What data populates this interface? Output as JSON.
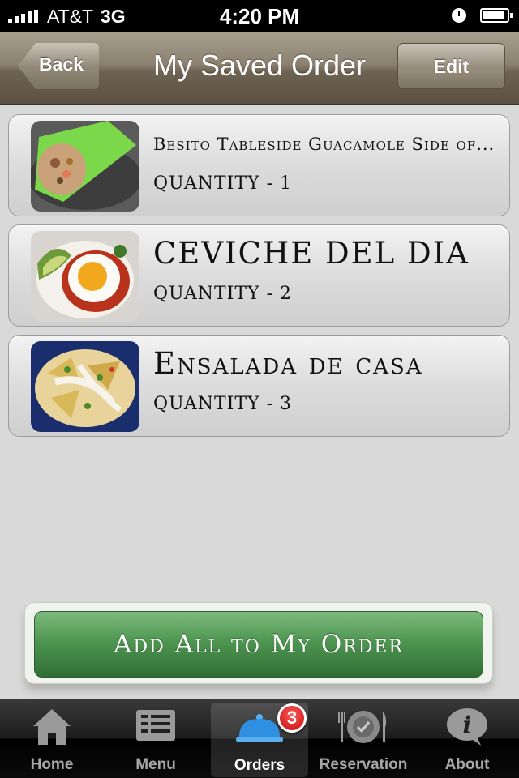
{
  "status_bar": {
    "carrier": "AT&T",
    "network": "3G",
    "time": "4:20 PM"
  },
  "nav": {
    "back_label": "Back",
    "title": "My Saved Order",
    "edit_label": "Edit"
  },
  "order_items": [
    {
      "name": "Besito Tableside Guacamole Side of...",
      "quantity": "QUANTITY - 1",
      "image": "burrito-wrap-photo"
    },
    {
      "name": "CEVICHE DEL DIA",
      "quantity": "QUANTITY - 2",
      "image": "fried-egg-tostada-photo"
    },
    {
      "name": "Ensalada de casa",
      "quantity": "QUANTITY - 3",
      "image": "chilaquiles-plate-photo"
    }
  ],
  "add_all_label": "Add All to My Order",
  "tabs": [
    {
      "label": "Home",
      "icon": "house-icon"
    },
    {
      "label": "Menu",
      "icon": "menu-list-icon"
    },
    {
      "label": "Orders",
      "icon": "cloche-icon",
      "badge": "3",
      "active": true
    },
    {
      "label": "Reservation",
      "icon": "plate-fork-knife-icon"
    },
    {
      "label": "About",
      "icon": "info-bubble-icon"
    }
  ],
  "colors": {
    "nav_bar": "#8c8170",
    "add_button": "#4f9652",
    "badge": "#d41a1a"
  }
}
